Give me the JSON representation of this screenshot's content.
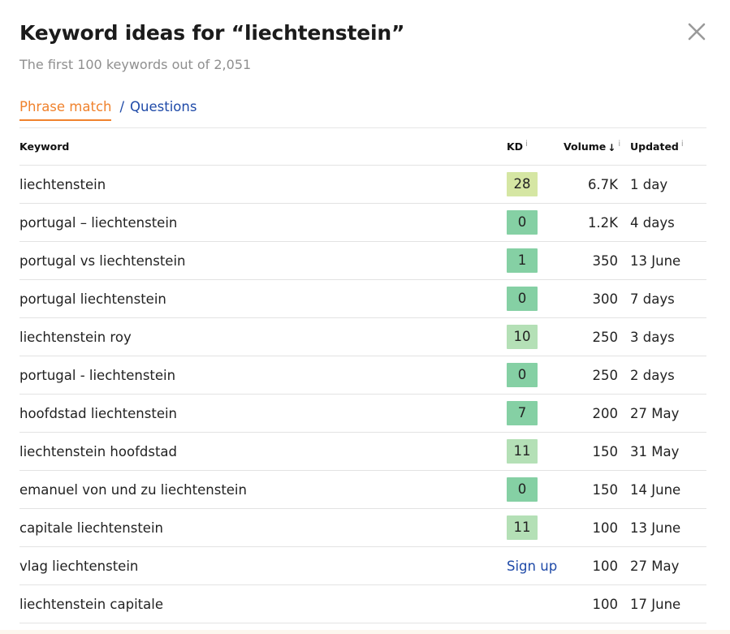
{
  "modal": {
    "title": "Keyword ideas for “liechtenstein”",
    "subtitle": "The first 100 keywords out of 2,051",
    "close_icon": "close-icon"
  },
  "tabs": {
    "active": "Phrase match",
    "separator": "/",
    "other": "Questions",
    "active_color": "#f0822d",
    "link_color": "#1f4aa8"
  },
  "table": {
    "headers": {
      "keyword": "Keyword",
      "kd": "KD",
      "volume": "Volume",
      "updated": "Updated",
      "info_mark": "i",
      "sort_arrow": "↓"
    },
    "rows": [
      {
        "keyword": "liechtenstein",
        "kd": "28",
        "kd_color": "#d5e6a3",
        "volume": "6.7K",
        "updated": "1 day"
      },
      {
        "keyword": "portugal – liechtenstein",
        "kd": "0",
        "kd_color": "#85d0a4",
        "volume": "1.2K",
        "updated": "4 days"
      },
      {
        "keyword": "portugal vs liechtenstein",
        "kd": "1",
        "kd_color": "#85d0a4",
        "volume": "350",
        "updated": "13 June"
      },
      {
        "keyword": "portugal liechtenstein",
        "kd": "0",
        "kd_color": "#85d0a4",
        "volume": "300",
        "updated": "7 days"
      },
      {
        "keyword": "liechtenstein roy",
        "kd": "10",
        "kd_color": "#b4e0b6",
        "volume": "250",
        "updated": "3 days"
      },
      {
        "keyword": "portugal - liechtenstein",
        "kd": "0",
        "kd_color": "#85d0a4",
        "volume": "250",
        "updated": "2 days"
      },
      {
        "keyword": "hoofdstad liechtenstein",
        "kd": "7",
        "kd_color": "#85d0a4",
        "volume": "200",
        "updated": "27 May"
      },
      {
        "keyword": "liechtenstein hoofdstad",
        "kd": "11",
        "kd_color": "#b4e0b6",
        "volume": "150",
        "updated": "31 May"
      },
      {
        "keyword": "emanuel von und zu liechtenstein",
        "kd": "0",
        "kd_color": "#85d0a4",
        "volume": "150",
        "updated": "14 June"
      },
      {
        "keyword": "capitale liechtenstein",
        "kd": "11",
        "kd_color": "#b4e0b6",
        "volume": "100",
        "updated": "13 June"
      },
      {
        "keyword": "vlag liechtenstein",
        "kd": "Sign up",
        "kd_color": "",
        "volume": "100",
        "updated": "27 May"
      },
      {
        "keyword": "liechtenstein capitale",
        "kd": "",
        "kd_color": "",
        "volume": "100",
        "updated": "17 June"
      }
    ]
  }
}
